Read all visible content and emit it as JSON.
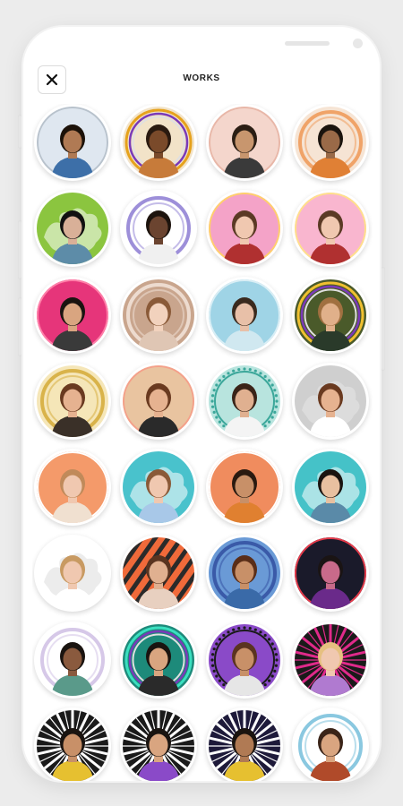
{
  "header": {
    "title": "WORKS",
    "close_icon": "close-icon"
  },
  "works": [
    {
      "bg": "#dfe7f0",
      "ring": "#b8c2cc",
      "skin": "#b07a54",
      "hair": "#1c1209",
      "shirt": "#3d6fa8",
      "style": "plain"
    },
    {
      "bg": "#f2e3c8",
      "ring": "#e6a21c",
      "skin": "#7a4a2a",
      "hair": "#2a1a10",
      "shirt": "#c77b3a",
      "style": "rings-multi"
    },
    {
      "bg": "#f4d6cc",
      "ring": "#e8b7a8",
      "skin": "#c8966e",
      "hair": "#2b1e14",
      "shirt": "#3a3a3a",
      "style": "plain"
    },
    {
      "bg": "#f6e4d4",
      "ring": "#f0a368",
      "skin": "#9a6a48",
      "hair": "#1b140e",
      "shirt": "#e08035",
      "style": "rings"
    },
    {
      "bg": "#8bc53f",
      "ring": "#ffffff",
      "skin": "#d9b098",
      "hair": "#111111",
      "shirt": "#5d8ca8",
      "style": "splash"
    },
    {
      "bg": "#ffffff",
      "ring": "#9d8fd9",
      "skin": "#6b4430",
      "hair": "#1d140e",
      "shirt": "#f0f0f0",
      "style": "rings"
    },
    {
      "bg": "#f4a3c8",
      "ring": "#ffd06a",
      "skin": "#f0c8b0",
      "hair": "#5b3a25",
      "shirt": "#b03030",
      "style": "plain"
    },
    {
      "bg": "#f9b6cf",
      "ring": "#ffe08a",
      "skin": "#f0c8b0",
      "hair": "#5b3a25",
      "shirt": "#b03030",
      "style": "plain"
    },
    {
      "bg": "#e6357a",
      "ring": "#ff7fa8",
      "skin": "#d9a580",
      "hair": "#1a1410",
      "shirt": "#3a3a3a",
      "style": "plain"
    },
    {
      "bg": "#c9a58d",
      "ring": "#eddbcf",
      "skin": "#f2d2bd",
      "hair": "#8a5a38",
      "shirt": "#dfc6b4",
      "style": "rings"
    },
    {
      "bg": "#9fd4e6",
      "ring": "#d9eef5",
      "skin": "#e8c0a8",
      "hair": "#3a2a1e",
      "shirt": "#d0e8f0",
      "style": "plain"
    },
    {
      "bg": "#4a5a2a",
      "ring": "#f0c030",
      "skin": "#e0b08a",
      "hair": "#a07040",
      "shirt": "#2a3a2a",
      "style": "rings-multi"
    },
    {
      "bg": "#f5e6b8",
      "ring": "#d9b34a",
      "skin": "#e6b290",
      "hair": "#6a3a20",
      "shirt": "#3a3028",
      "style": "rings"
    },
    {
      "bg": "#e9c4a0",
      "ring": "#f4a08a",
      "skin": "#e6b290",
      "hair": "#6a3a20",
      "shirt": "#2a2a2a",
      "style": "plain"
    },
    {
      "bg": "#b8e4de",
      "ring": "#3ba79a",
      "skin": "#e0b090",
      "hair": "#3a2418",
      "shirt": "#f4f4f4",
      "style": "dots"
    },
    {
      "bg": "#cfcfcf",
      "ring": "#e8e8e8",
      "skin": "#e6b290",
      "hair": "#6a3a20",
      "shirt": "#ffffff",
      "style": "splash"
    },
    {
      "bg": "#f49a6a",
      "ring": "#ffffff",
      "skin": "#f0c8b0",
      "hair": "#c08a5a",
      "shirt": "#f0e0d0",
      "style": "plain"
    },
    {
      "bg": "#49c2cc",
      "ring": "#ffffff",
      "skin": "#f0c8b0",
      "hair": "#8a5a38",
      "shirt": "#a8c8e8",
      "style": "splash"
    },
    {
      "bg": "#f08c5e",
      "ring": "#ffffff",
      "skin": "#c89068",
      "hair": "#2a1a10",
      "shirt": "#e08030",
      "style": "plain"
    },
    {
      "bg": "#45c2c8",
      "ring": "#ffffff",
      "skin": "#e8c0a0",
      "hair": "#1a1410",
      "shirt": "#5a8aa8",
      "style": "splash"
    },
    {
      "bg": "#ffffff",
      "ring": "#dddddd",
      "skin": "#f0c8b0",
      "hair": "#c89a62",
      "shirt": "#ffffff",
      "style": "splash"
    },
    {
      "bg": "#f06a3a",
      "ring": "#2a2a2a",
      "skin": "#e0b090",
      "hair": "#5a3420",
      "shirt": "#e8d0c0",
      "style": "stripes"
    },
    {
      "bg": "#6a9ad6",
      "ring": "#3a5aa8",
      "skin": "#c89068",
      "hair": "#5a2e18",
      "shirt": "#3a6aa8",
      "style": "rings"
    },
    {
      "bg": "#1a1a2a",
      "ring": "#e63a4a",
      "skin": "#c86a8a",
      "hair": "#1a1414",
      "shirt": "#6a2a8a",
      "style": "plain"
    },
    {
      "bg": "#ffffff",
      "ring": "#d6c8e8",
      "skin": "#8a5a3e",
      "hair": "#1a1410",
      "shirt": "#5a9a8a",
      "style": "rings"
    },
    {
      "bg": "#1d8a7a",
      "ring": "#3ae0c0",
      "skin": "#d9a580",
      "hair": "#1a1410",
      "shirt": "#2a2a2a",
      "style": "rings-multi"
    },
    {
      "bg": "#8a4ac8",
      "ring": "#1a1a1a",
      "skin": "#c89068",
      "hair": "#5a3420",
      "shirt": "#e6e6e6",
      "style": "dots"
    },
    {
      "bg": "#1a1a1a",
      "ring": "#e02a8a",
      "skin": "#f0c8b0",
      "hair": "#e6c080",
      "shirt": "#b07ad0",
      "style": "burst"
    },
    {
      "bg": "#1a1a1a",
      "ring": "#ffffff",
      "skin": "#c89068",
      "hair": "#1a1410",
      "shirt": "#e6c030",
      "style": "burst"
    },
    {
      "bg": "#1a1a1a",
      "ring": "#ffffff",
      "skin": "#d9a580",
      "hair": "#1a1410",
      "shirt": "#8a4ac8",
      "style": "burst"
    },
    {
      "bg": "#1e1a3a",
      "ring": "#ffffff",
      "skin": "#b07a54",
      "hair": "#1a1410",
      "shirt": "#e6c030",
      "style": "burst"
    },
    {
      "bg": "#ffffff",
      "ring": "#8ac8e0",
      "skin": "#d9a580",
      "hair": "#3a2418",
      "shirt": "#b04a2a",
      "style": "rings"
    }
  ]
}
